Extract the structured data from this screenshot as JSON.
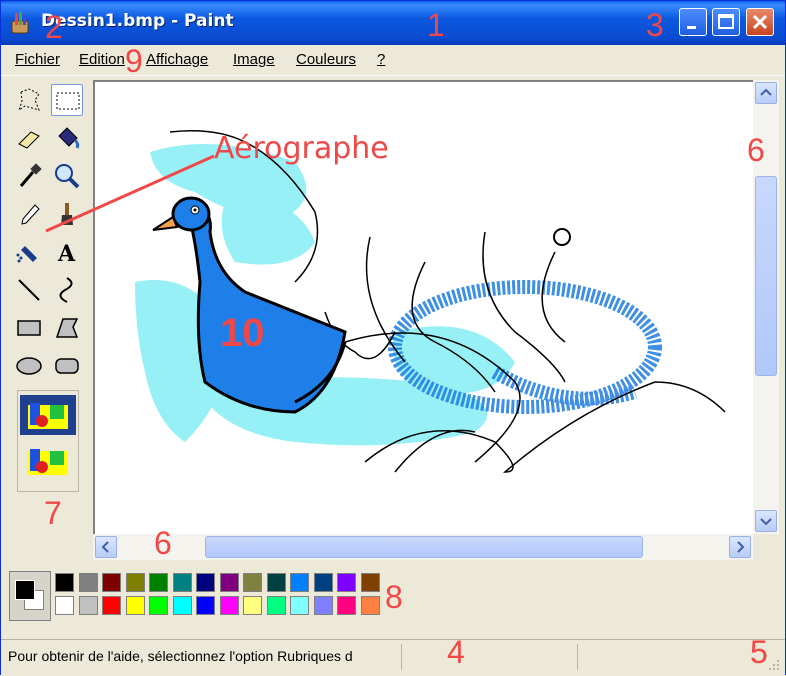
{
  "window": {
    "title": "Dessin1.bmp - Paint",
    "controls": {
      "minimize": "minimize-icon",
      "maximize": "maximize-icon",
      "close": "close-icon"
    }
  },
  "menu": {
    "items": [
      "Fichier",
      "Edition",
      "Affichage",
      "Image",
      "Couleurs",
      "?"
    ]
  },
  "toolbox": {
    "tools": [
      "free-select-icon",
      "rect-select-icon",
      "eraser-icon",
      "fill-bucket-icon",
      "color-picker-icon",
      "magnifier-icon",
      "pencil-icon",
      "brush-icon",
      "airbrush-icon",
      "text-icon",
      "line-icon",
      "curve-icon",
      "rectangle-icon",
      "polygon-icon",
      "ellipse-icon",
      "rounded-rect-icon"
    ],
    "active_tool": "rect-select-icon"
  },
  "palette": {
    "foreground": "#000000",
    "background": "#FFFFFF",
    "row1": [
      "#000000",
      "#808080",
      "#800000",
      "#808000",
      "#008000",
      "#008080",
      "#000080",
      "#800080",
      "#808040",
      "#004040",
      "#0080FF",
      "#004080",
      "#8000FF",
      "#804000"
    ],
    "row2": [
      "#FFFFFF",
      "#C0C0C0",
      "#FF0000",
      "#FFFF00",
      "#00FF00",
      "#00FFFF",
      "#0000FF",
      "#FF00FF",
      "#FFFF80",
      "#00FF80",
      "#80FFFF",
      "#8080FF",
      "#FF0080",
      "#FF8040"
    ]
  },
  "status": {
    "text": "Pour obtenir de l'aide, sélectionnez l'option Rubriques d"
  },
  "annotations": {
    "n1": "1",
    "n2": "2",
    "n3": "3",
    "n4": "4",
    "n5": "5",
    "n6a": "6",
    "n6b": "6",
    "n7": "7",
    "n8": "8",
    "n9": "9",
    "n10": "10",
    "label": "Aérographe"
  },
  "colors": {
    "titlebar": "#0A4BD0",
    "annotation": "#F04848",
    "spray_light": "#8BEFF5",
    "spray_dark": "#1E7CE0",
    "duck": "#1F7FE8"
  }
}
